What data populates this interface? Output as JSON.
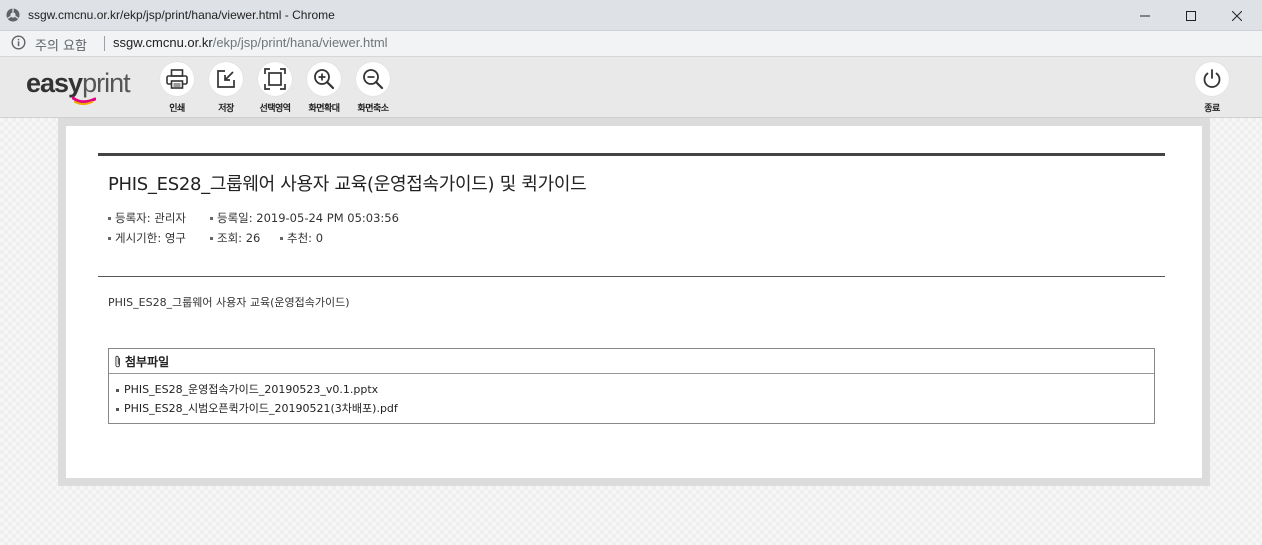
{
  "window": {
    "title": "ssgw.cmcnu.or.kr/ekp/jsp/print/hana/viewer.html - Chrome"
  },
  "addressbar": {
    "security_text": "주의 요함",
    "url_host": "ssgw.cmcnu.or.kr",
    "url_path": "/ekp/jsp/print/hana/viewer.html"
  },
  "toolbar": {
    "logo_easy": "easy",
    "logo_print": "print",
    "tools": [
      {
        "label": "인쇄",
        "icon": "printer-icon"
      },
      {
        "label": "저장",
        "icon": "save-icon"
      },
      {
        "label": "선택영역",
        "icon": "select-area-icon"
      },
      {
        "label": "화면확대",
        "icon": "zoom-in-icon"
      },
      {
        "label": "화면축소",
        "icon": "zoom-out-icon"
      }
    ],
    "exit_label": "종료"
  },
  "document": {
    "title": "PHIS_ES28_그룹웨어 사용자 교육(운영접속가이드) 및 퀵가이드",
    "meta": {
      "author": "등록자: 관리자",
      "date": "등록일: 2019-05-24 PM 05:03:56",
      "period": "게시기한: 영구",
      "views": "조회: 26",
      "recommend": "추천: 0"
    },
    "body": "PHIS_ES28_그룹웨어 사용자 교육(운영접속가이드)",
    "attachments": {
      "header": "첨부파일",
      "files": [
        "PHIS_ES28_운영접속가이드_20190523_v0.1.pptx",
        "PHIS_ES28_시범오픈퀵가이드_20190521(3차배포).pdf"
      ]
    }
  },
  "colors": {
    "toolbar_bg": "#e9e9e9",
    "title_rule": "#444444",
    "logo_accent": "#e4007f"
  }
}
